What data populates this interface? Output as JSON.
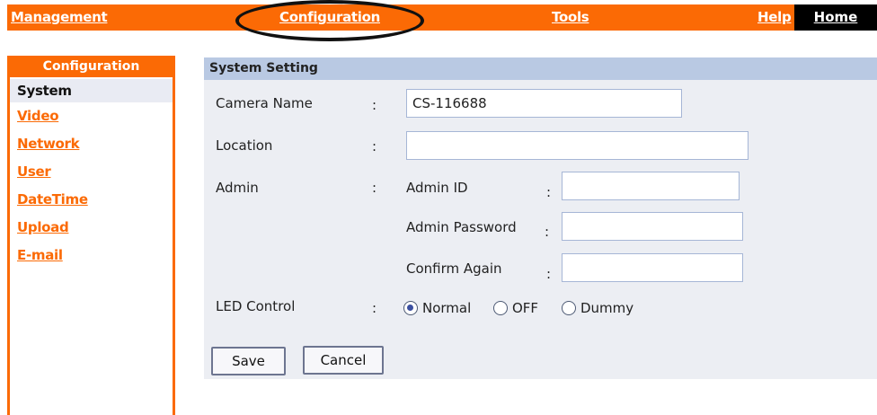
{
  "topnav": {
    "management": "Management",
    "configuration": "Configuration",
    "tools": "Tools",
    "help": "Help",
    "home": "Home"
  },
  "sidebar": {
    "title": "Configuration",
    "items": [
      {
        "label": "System",
        "active": true
      },
      {
        "label": "Video"
      },
      {
        "label": "Network"
      },
      {
        "label": "User"
      },
      {
        "label": "DateTime"
      },
      {
        "label": "Upload"
      },
      {
        "label": "E-mail"
      }
    ]
  },
  "panel": {
    "title": "System Setting",
    "camera_name_label": "Camera Name",
    "camera_name_value": "CS-116688",
    "location_label": "Location",
    "location_value": "",
    "admin_label": "Admin",
    "admin_id_label": "Admin ID",
    "admin_id_value": "",
    "admin_password_label": "Admin Password",
    "admin_password_value": "",
    "confirm_label": "Confirm Again",
    "confirm_value": "",
    "colon": ":",
    "led_label": "LED Control",
    "led_options": [
      "Normal",
      "OFF",
      "Dummy"
    ],
    "led_selected": "Normal",
    "save_label": "Save",
    "cancel_label": "Cancel"
  },
  "colors": {
    "accent": "#fb6a05",
    "panel_header": "#b9c9e3",
    "panel_bg": "#eceef3"
  }
}
